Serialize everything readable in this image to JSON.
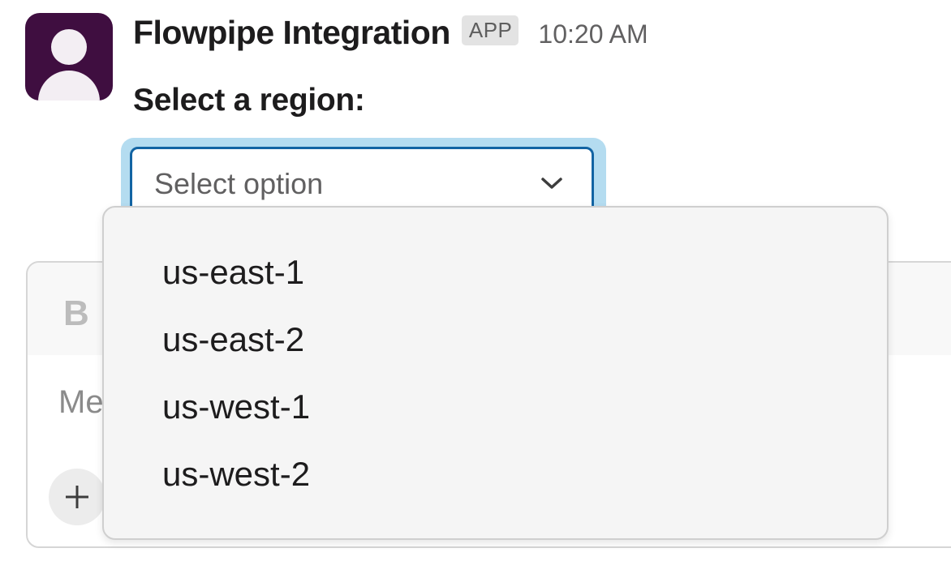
{
  "message": {
    "sender": "Flowpipe Integration",
    "badge": "APP",
    "timestamp": "10:20 AM",
    "question": "Select a region:"
  },
  "select": {
    "placeholder": "Select option",
    "options": [
      "us-east-1",
      "us-east-2",
      "us-west-1",
      "us-west-2"
    ]
  },
  "composer": {
    "bold_label": "B",
    "input_placeholder_visible": "Me"
  },
  "icons": {
    "avatar": "user-avatar-icon",
    "chevron": "chevron-down-icon",
    "plus": "plus-icon"
  },
  "colors": {
    "avatar_bg": "#3f0e40",
    "focus_border": "#1264a3",
    "focus_glow": "#b4dcf0"
  }
}
